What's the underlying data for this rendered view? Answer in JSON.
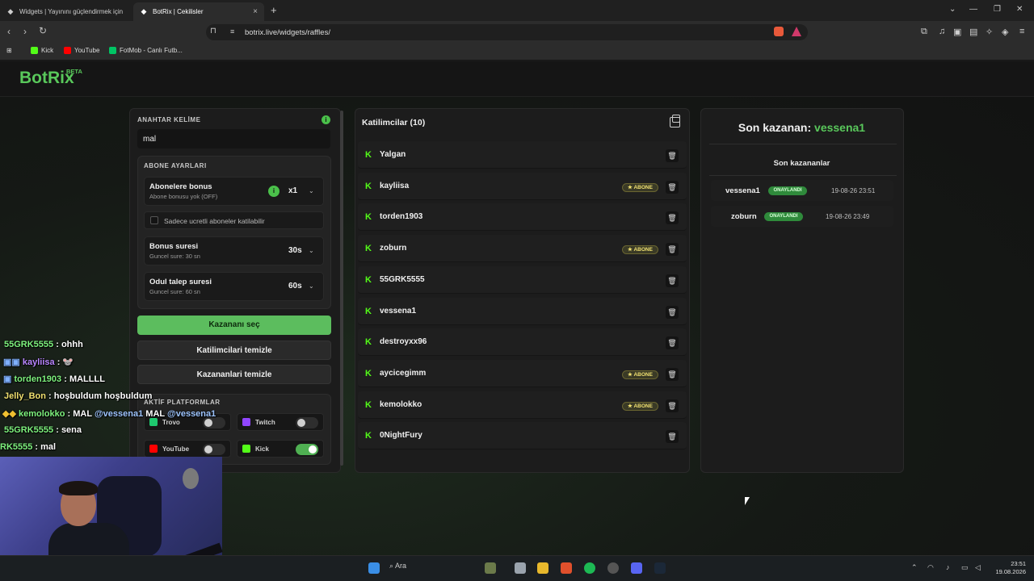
{
  "browser": {
    "tabs": [
      {
        "label": "Widgets | Yayınını güçlendirmek için"
      },
      {
        "label": "BotRix | Cekilisler"
      }
    ],
    "url": "botrix.live/widgets/raffles/",
    "bookmarks": [
      {
        "label": "Kick",
        "color": "#53fc18"
      },
      {
        "label": "YouTube",
        "color": "#ff0000"
      },
      {
        "label": "FotMob - Canlı Futb...",
        "color": "#00c464"
      }
    ]
  },
  "header": {
    "logo": "BotRix",
    "badge": "BETA"
  },
  "settings": {
    "keyword_label": "ANAHTAR KELİME",
    "keyword_value": "mal",
    "sub_settings_label": "ABONE AYARLARI",
    "bonus": {
      "title": "Abonelere bonus",
      "subtitle": "Abone bonusu yok (OFF)",
      "value": "x1"
    },
    "paid_only": {
      "label": "Sadece ucretli aboneler katilabilir"
    },
    "bonus_duration": {
      "title": "Bonus suresi",
      "subtitle": "Guncel sure: 30 sn",
      "value": "30s"
    },
    "claim_duration": {
      "title": "Odul talep suresi",
      "subtitle": "Guncel sure: 60 sn",
      "value": "60s"
    },
    "pick_winner": "Kazananı seç",
    "clear_participants": "Katilimcilari temizle",
    "clear_winners": "Kazananlari temizle",
    "platforms_label": "AKTİF PLATFORMLAR",
    "platforms": [
      {
        "name": "Trovo",
        "on": false,
        "color": "#1ec86e"
      },
      {
        "name": "Twitch",
        "on": false,
        "color": "#9146ff"
      },
      {
        "name": "YouTube",
        "on": false,
        "color": "#ff0000"
      },
      {
        "name": "Kick",
        "on": true,
        "color": "#53fc18"
      }
    ]
  },
  "participants": {
    "title": "Katilimcilar (10)",
    "badge_label": "ABONE",
    "list": [
      {
        "name": "Yalgan",
        "sub": false
      },
      {
        "name": "kayliisa",
        "sub": true
      },
      {
        "name": "torden1903",
        "sub": false
      },
      {
        "name": "zoburn",
        "sub": true
      },
      {
        "name": "55GRK5555",
        "sub": false
      },
      {
        "name": "vessena1",
        "sub": false
      },
      {
        "name": "destroyxx96",
        "sub": false
      },
      {
        "name": "aycicegimm",
        "sub": true
      },
      {
        "name": "kemolokko",
        "sub": true
      },
      {
        "name": "0NightFury",
        "sub": false
      }
    ]
  },
  "winners": {
    "last_label": "Son kazanan:",
    "last_name": "vessena1",
    "recent_label": "Son kazananlar",
    "list": [
      {
        "name": "vessena1",
        "status": "ONAYLANDI",
        "time": "19-08-26 23:51"
      },
      {
        "name": "zoburn",
        "status": "ONAYLANDI",
        "time": "19-08-26 23:49"
      }
    ]
  },
  "chat": [
    {
      "user": "55GRK5555",
      "msg": ": ohhh"
    },
    {
      "user": "kayliisa",
      "msg": ":"
    },
    {
      "user": "torden1903",
      "msg": ": MALLLL"
    },
    {
      "user": "Jelly_Bon",
      "msg": ": hoşbuldum hoşbuldum"
    },
    {
      "user": "kemolokko",
      "msg": ": MAL",
      "mention1": "@vessena1",
      "mid": "MAL",
      "mention2": "@vessena1"
    },
    {
      "user": "55GRK5555",
      "msg": ": sena"
    },
    {
      "user": "RK5555",
      "msg": ": mal"
    }
  ],
  "taskbar": {
    "search": "Ara",
    "time": "23:51",
    "date": "19.08.2026"
  }
}
